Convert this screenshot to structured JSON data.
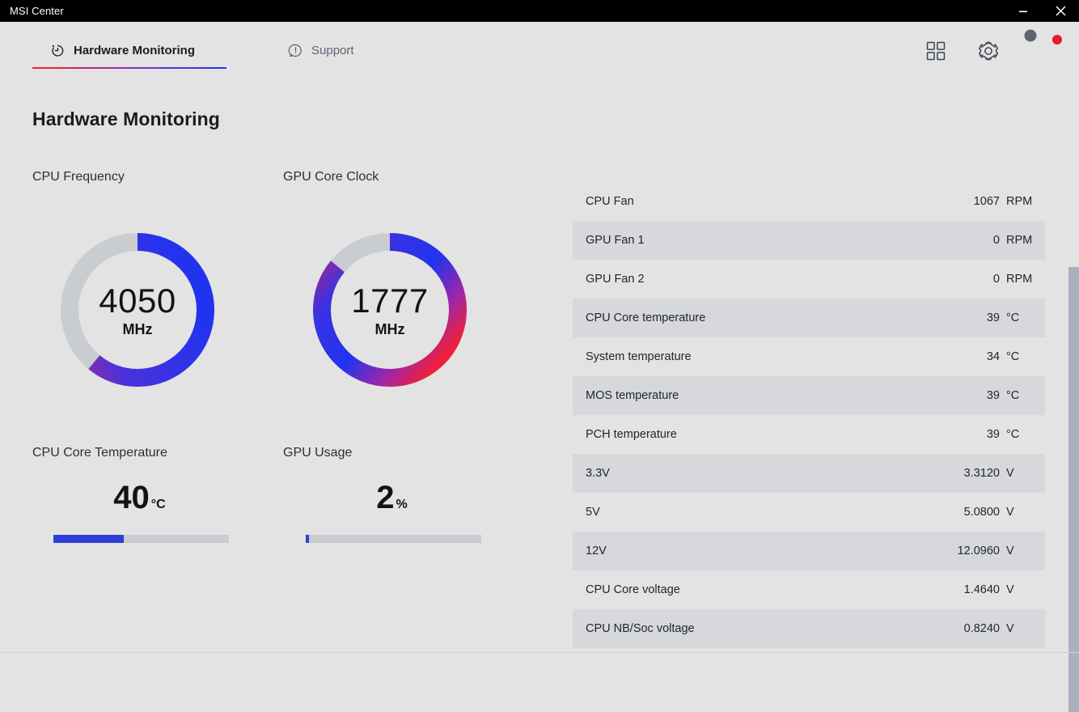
{
  "window": {
    "title": "MSI Center",
    "minimize_label": "Minimize",
    "close_label": "Close"
  },
  "nav": {
    "tabs": [
      {
        "label": "Hardware Monitoring",
        "icon": "timer-icon",
        "active": true
      },
      {
        "label": "Support",
        "icon": "help-bubble-icon",
        "active": false
      }
    ],
    "actions": [
      {
        "name": "apps-grid-icon",
        "label": "Apps"
      },
      {
        "name": "gear-icon",
        "label": "Settings"
      },
      {
        "name": "avatar",
        "label": "Account"
      }
    ]
  },
  "page": {
    "title": "Hardware Monitoring"
  },
  "gauges": [
    {
      "label": "CPU Frequency",
      "value": "4050",
      "unit": "MHz",
      "percent": 61,
      "gradient_start": "#a32a8e",
      "gradient_end": "#2233ee",
      "track_color": "#c9ccd1"
    },
    {
      "label": "GPU Core Clock",
      "value": "1777",
      "unit": "MHz",
      "percent": 86,
      "gradient_start": "#8f2a9e",
      "gradient_end": "#f01f3c",
      "track_color": "#c9ccd1"
    }
  ],
  "bars": [
    {
      "label": "CPU Core Temperature",
      "value": "40",
      "unit": "°C",
      "percent": 40,
      "fill_color": "#2f3ed8"
    },
    {
      "label": "GPU Usage",
      "value": "2",
      "unit": "%",
      "percent": 2,
      "fill_color": "#2f3ed8"
    }
  ],
  "sensors": {
    "rows": [
      {
        "name": "CPU Fan",
        "value": "1067",
        "unit": "RPM"
      },
      {
        "name": "GPU Fan 1",
        "value": "0",
        "unit": "RPM"
      },
      {
        "name": "GPU Fan 2",
        "value": "0",
        "unit": "RPM"
      },
      {
        "name": "CPU Core temperature",
        "value": "39",
        "unit": "°C"
      },
      {
        "name": "System temperature",
        "value": "34",
        "unit": "°C"
      },
      {
        "name": "MOS temperature",
        "value": "39",
        "unit": "°C"
      },
      {
        "name": "PCH temperature",
        "value": "39",
        "unit": "°C"
      },
      {
        "name": "3.3V",
        "value": "3.3120",
        "unit": "V"
      },
      {
        "name": "5V",
        "value": "5.0800",
        "unit": "V"
      },
      {
        "name": "12V",
        "value": "12.0960",
        "unit": "V"
      },
      {
        "name": "CPU Core voltage",
        "value": "1.4640",
        "unit": "V"
      },
      {
        "name": "CPU NB/Soc voltage",
        "value": "0.8240",
        "unit": "V"
      }
    ]
  },
  "colors": {
    "background": "#e3e3e3",
    "titlebar": "#000000",
    "accent_red": "#ff2020",
    "accent_blue": "#2233ee",
    "row_alt": "#d6d8dc",
    "scrollbar_thumb": "#aab0c0"
  }
}
